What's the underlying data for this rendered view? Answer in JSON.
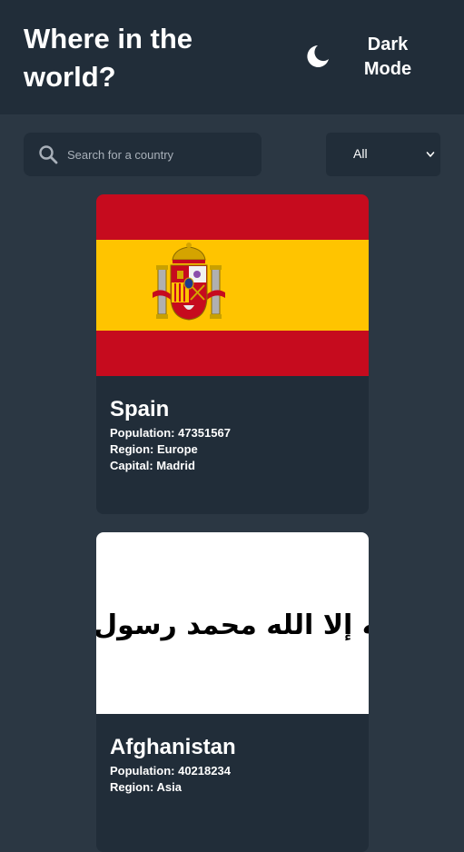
{
  "header": {
    "title": "Where in the world?",
    "theme_toggle": {
      "label": "Dark Mode",
      "icon": "moon-icon"
    }
  },
  "search": {
    "placeholder": "Search for a country",
    "value": "",
    "icon": "search-icon"
  },
  "filter": {
    "selected": "All",
    "icon": "chevron-down-icon"
  },
  "countries": [
    {
      "name": "Spain",
      "population": "Population: 47351567",
      "region": "Region: Europe",
      "capital": "Capital: Madrid",
      "flag": {
        "colors": [
          "#c60b1e",
          "#ffc400",
          "#c60b1e"
        ]
      }
    },
    {
      "name": "Afghanistan",
      "population": "Population: 40218234",
      "region": "Region: Asia",
      "capital": "",
      "flag": {
        "background": "#ffffff",
        "script_color": "#000000",
        "emblem_text": "لا إله إلا الله محمد رسول الله"
      }
    }
  ],
  "colors": {
    "background": "#2b3743",
    "elements": "#212d39",
    "text": "#ffffff",
    "placeholder": "#a8b0b9"
  }
}
